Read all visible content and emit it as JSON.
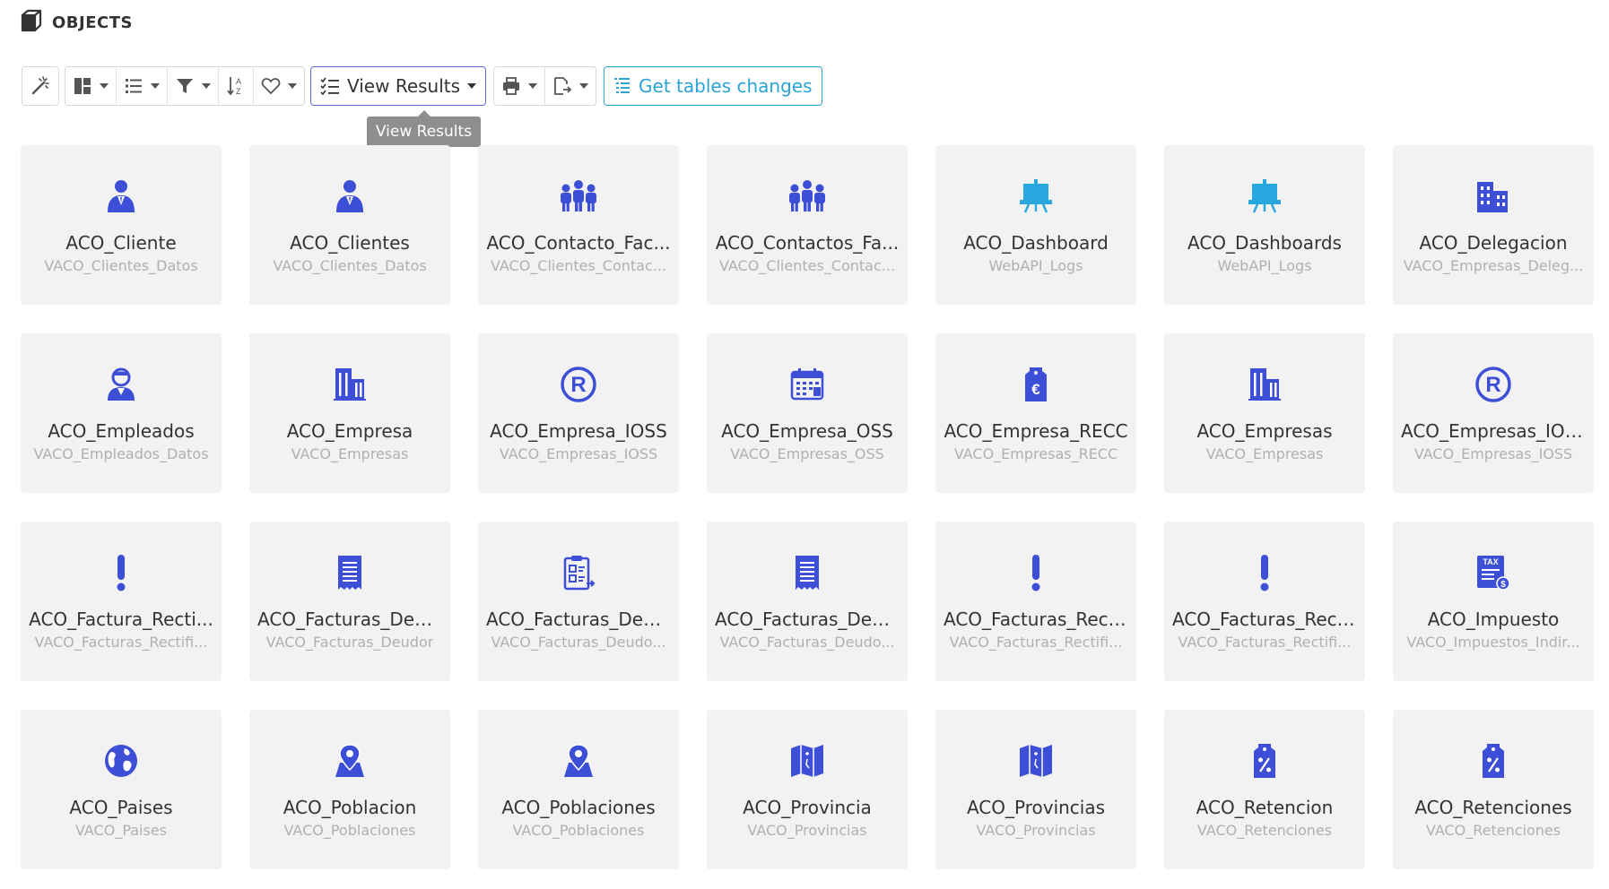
{
  "header": {
    "title": "OBJECTS",
    "icon": "cube-icon"
  },
  "toolbar": {
    "view_results_label": "View Results",
    "get_tables_label": "Get tables changes",
    "tooltip": "View Results"
  },
  "colors": {
    "icon_blue": "#3d4fd6",
    "icon_cyan": "#29a8df",
    "card_bg": "#f2f2f2",
    "accent_cyan": "#2aa3d6"
  },
  "objects": [
    {
      "name": "ACO_Cliente",
      "source": "VACO_Clientes_Datos",
      "icon": "person-icon"
    },
    {
      "name": "ACO_Clientes",
      "source": "VACO_Clientes_Datos",
      "icon": "person-icon"
    },
    {
      "name": "ACO_Contacto_Fac...",
      "source": "VACO_Clientes_Contac...",
      "icon": "people-group-icon"
    },
    {
      "name": "ACO_Contactos_Fa...",
      "source": "VACO_Clientes_Contac...",
      "icon": "people-group-icon"
    },
    {
      "name": "ACO_Dashboard",
      "source": "WebAPI_Logs",
      "icon": "presentation-board-icon"
    },
    {
      "name": "ACO_Dashboards",
      "source": "WebAPI_Logs",
      "icon": "presentation-board-icon"
    },
    {
      "name": "ACO_Delegacion",
      "source": "VACO_Empresas_Deleg...",
      "icon": "buildings-icon"
    },
    {
      "name": "ACO_Empleados",
      "source": "VACO_Empleados_Datos",
      "icon": "employee-icon"
    },
    {
      "name": "ACO_Empresa",
      "source": "VACO_Empresas",
      "icon": "company-building-icon"
    },
    {
      "name": "ACO_Empresa_IOSS",
      "source": "VACO_Empresas_IOSS",
      "icon": "registered-icon"
    },
    {
      "name": "ACO_Empresa_OSS",
      "source": "VACO_Empresas_OSS",
      "icon": "calendar-icon"
    },
    {
      "name": "ACO_Empresa_RECC",
      "source": "VACO_Empresas_RECC",
      "icon": "euro-tag-icon"
    },
    {
      "name": "ACO_Empresas",
      "source": "VACO_Empresas",
      "icon": "company-building-icon"
    },
    {
      "name": "ACO_Empresas_IOSS",
      "source": "VACO_Empresas_IOSS",
      "icon": "registered-icon"
    },
    {
      "name": "ACO_Factura_Recti...",
      "source": "VACO_Facturas_Rectifi...",
      "icon": "exclamation-icon"
    },
    {
      "name": "ACO_Facturas_Deu...",
      "source": "VACO_Facturas_Deudor",
      "icon": "receipt-icon"
    },
    {
      "name": "ACO_Facturas_Deu...",
      "source": "VACO_Facturas_Deudo...",
      "icon": "clipboard-icon"
    },
    {
      "name": "ACO_Facturas_Deu...",
      "source": "VACO_Facturas_Deudo...",
      "icon": "receipt-icon"
    },
    {
      "name": "ACO_Facturas_Rect...",
      "source": "VACO_Facturas_Rectifi...",
      "icon": "exclamation-icon"
    },
    {
      "name": "ACO_Facturas_Rect...",
      "source": "VACO_Facturas_Rectifi...",
      "icon": "exclamation-icon"
    },
    {
      "name": "ACO_Impuesto",
      "source": "VACO_Impuestos_Indir...",
      "icon": "tax-document-icon"
    },
    {
      "name": "ACO_Paises",
      "source": "VACO_Paises",
      "icon": "globe-icon"
    },
    {
      "name": "ACO_Poblacion",
      "source": "VACO_Poblaciones",
      "icon": "map-pin-icon"
    },
    {
      "name": "ACO_Poblaciones",
      "source": "VACO_Poblaciones",
      "icon": "map-pin-icon"
    },
    {
      "name": "ACO_Provincia",
      "source": "VACO_Provincias",
      "icon": "folded-map-icon"
    },
    {
      "name": "ACO_Provincias",
      "source": "VACO_Provincias",
      "icon": "folded-map-icon"
    },
    {
      "name": "ACO_Retencion",
      "source": "VACO_Retenciones",
      "icon": "percent-tag-icon"
    },
    {
      "name": "ACO_Retenciones",
      "source": "VACO_Retenciones",
      "icon": "percent-tag-icon"
    }
  ]
}
